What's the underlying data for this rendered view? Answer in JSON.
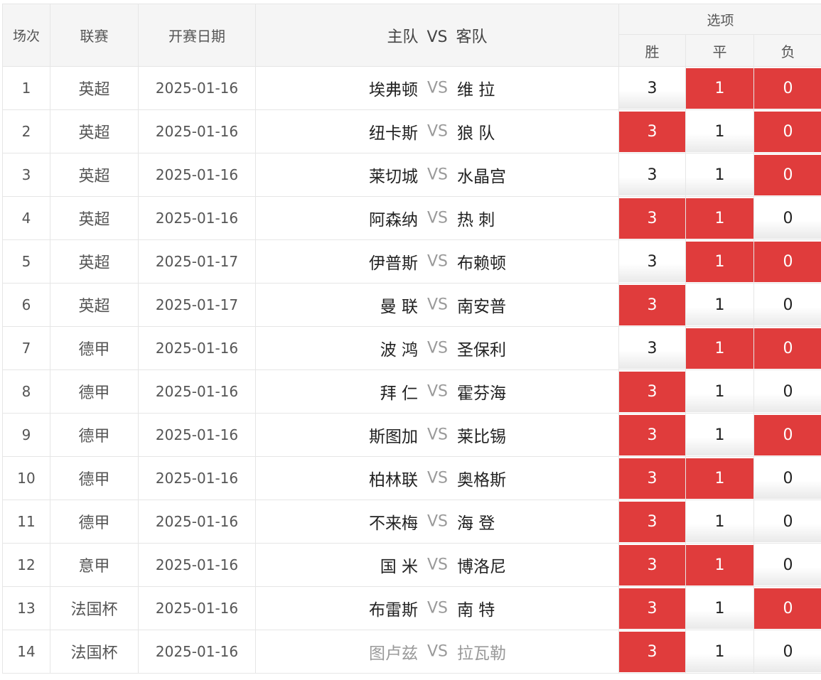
{
  "header": {
    "index": "场次",
    "league": "联赛",
    "date": "开赛日期",
    "home": "主队",
    "vs": "VS",
    "away": "客队",
    "options": "选项",
    "win": "胜",
    "draw": "平",
    "lose": "负"
  },
  "colors": {
    "selected": "#e03c3c",
    "header_bg": "#f5f5f5"
  },
  "rows": [
    {
      "index": "1",
      "league": "英超",
      "date": "2025-01-16",
      "home": "埃弗顿",
      "vs": "VS",
      "away": "维 拉",
      "win": "3",
      "draw": "1",
      "lose": "0",
      "win_sel": false,
      "draw_sel": true,
      "lose_sel": true
    },
    {
      "index": "2",
      "league": "英超",
      "date": "2025-01-16",
      "home": "纽卡斯",
      "vs": "VS",
      "away": "狼 队",
      "win": "3",
      "draw": "1",
      "lose": "0",
      "win_sel": true,
      "draw_sel": false,
      "lose_sel": true
    },
    {
      "index": "3",
      "league": "英超",
      "date": "2025-01-16",
      "home": "莱切城",
      "vs": "VS",
      "away": "水晶宫",
      "win": "3",
      "draw": "1",
      "lose": "0",
      "win_sel": false,
      "draw_sel": false,
      "lose_sel": true
    },
    {
      "index": "4",
      "league": "英超",
      "date": "2025-01-16",
      "home": "阿森纳",
      "vs": "VS",
      "away": "热 刺",
      "win": "3",
      "draw": "1",
      "lose": "0",
      "win_sel": true,
      "draw_sel": true,
      "lose_sel": false
    },
    {
      "index": "5",
      "league": "英超",
      "date": "2025-01-17",
      "home": "伊普斯",
      "vs": "VS",
      "away": "布赖顿",
      "win": "3",
      "draw": "1",
      "lose": "0",
      "win_sel": false,
      "draw_sel": true,
      "lose_sel": true
    },
    {
      "index": "6",
      "league": "英超",
      "date": "2025-01-17",
      "home": "曼 联",
      "vs": "VS",
      "away": "南安普",
      "win": "3",
      "draw": "1",
      "lose": "0",
      "win_sel": true,
      "draw_sel": false,
      "lose_sel": false
    },
    {
      "index": "7",
      "league": "德甲",
      "date": "2025-01-16",
      "home": "波 鸿",
      "vs": "VS",
      "away": "圣保利",
      "win": "3",
      "draw": "1",
      "lose": "0",
      "win_sel": false,
      "draw_sel": true,
      "lose_sel": true
    },
    {
      "index": "8",
      "league": "德甲",
      "date": "2025-01-16",
      "home": "拜 仁",
      "vs": "VS",
      "away": "霍芬海",
      "win": "3",
      "draw": "1",
      "lose": "0",
      "win_sel": true,
      "draw_sel": false,
      "lose_sel": false
    },
    {
      "index": "9",
      "league": "德甲",
      "date": "2025-01-16",
      "home": "斯图加",
      "vs": "VS",
      "away": "莱比锡",
      "win": "3",
      "draw": "1",
      "lose": "0",
      "win_sel": true,
      "draw_sel": false,
      "lose_sel": true
    },
    {
      "index": "10",
      "league": "德甲",
      "date": "2025-01-16",
      "home": "柏林联",
      "vs": "VS",
      "away": "奥格斯",
      "win": "3",
      "draw": "1",
      "lose": "0",
      "win_sel": true,
      "draw_sel": true,
      "lose_sel": false
    },
    {
      "index": "11",
      "league": "德甲",
      "date": "2025-01-16",
      "home": "不来梅",
      "vs": "VS",
      "away": "海 登",
      "win": "3",
      "draw": "1",
      "lose": "0",
      "win_sel": true,
      "draw_sel": false,
      "lose_sel": false
    },
    {
      "index": "12",
      "league": "意甲",
      "date": "2025-01-16",
      "home": "国 米",
      "vs": "VS",
      "away": "博洛尼",
      "win": "3",
      "draw": "1",
      "lose": "0",
      "win_sel": true,
      "draw_sel": true,
      "lose_sel": false
    },
    {
      "index": "13",
      "league": "法国杯",
      "date": "2025-01-16",
      "home": "布雷斯",
      "vs": "VS",
      "away": "南 特",
      "win": "3",
      "draw": "1",
      "lose": "0",
      "win_sel": true,
      "draw_sel": false,
      "lose_sel": true
    },
    {
      "index": "14",
      "league": "法国杯",
      "date": "2025-01-16",
      "home": "图卢兹",
      "vs": "VS",
      "away": "拉瓦勒",
      "win": "3",
      "draw": "1",
      "lose": "0",
      "win_sel": true,
      "draw_sel": false,
      "lose_sel": false,
      "dim": true
    }
  ]
}
